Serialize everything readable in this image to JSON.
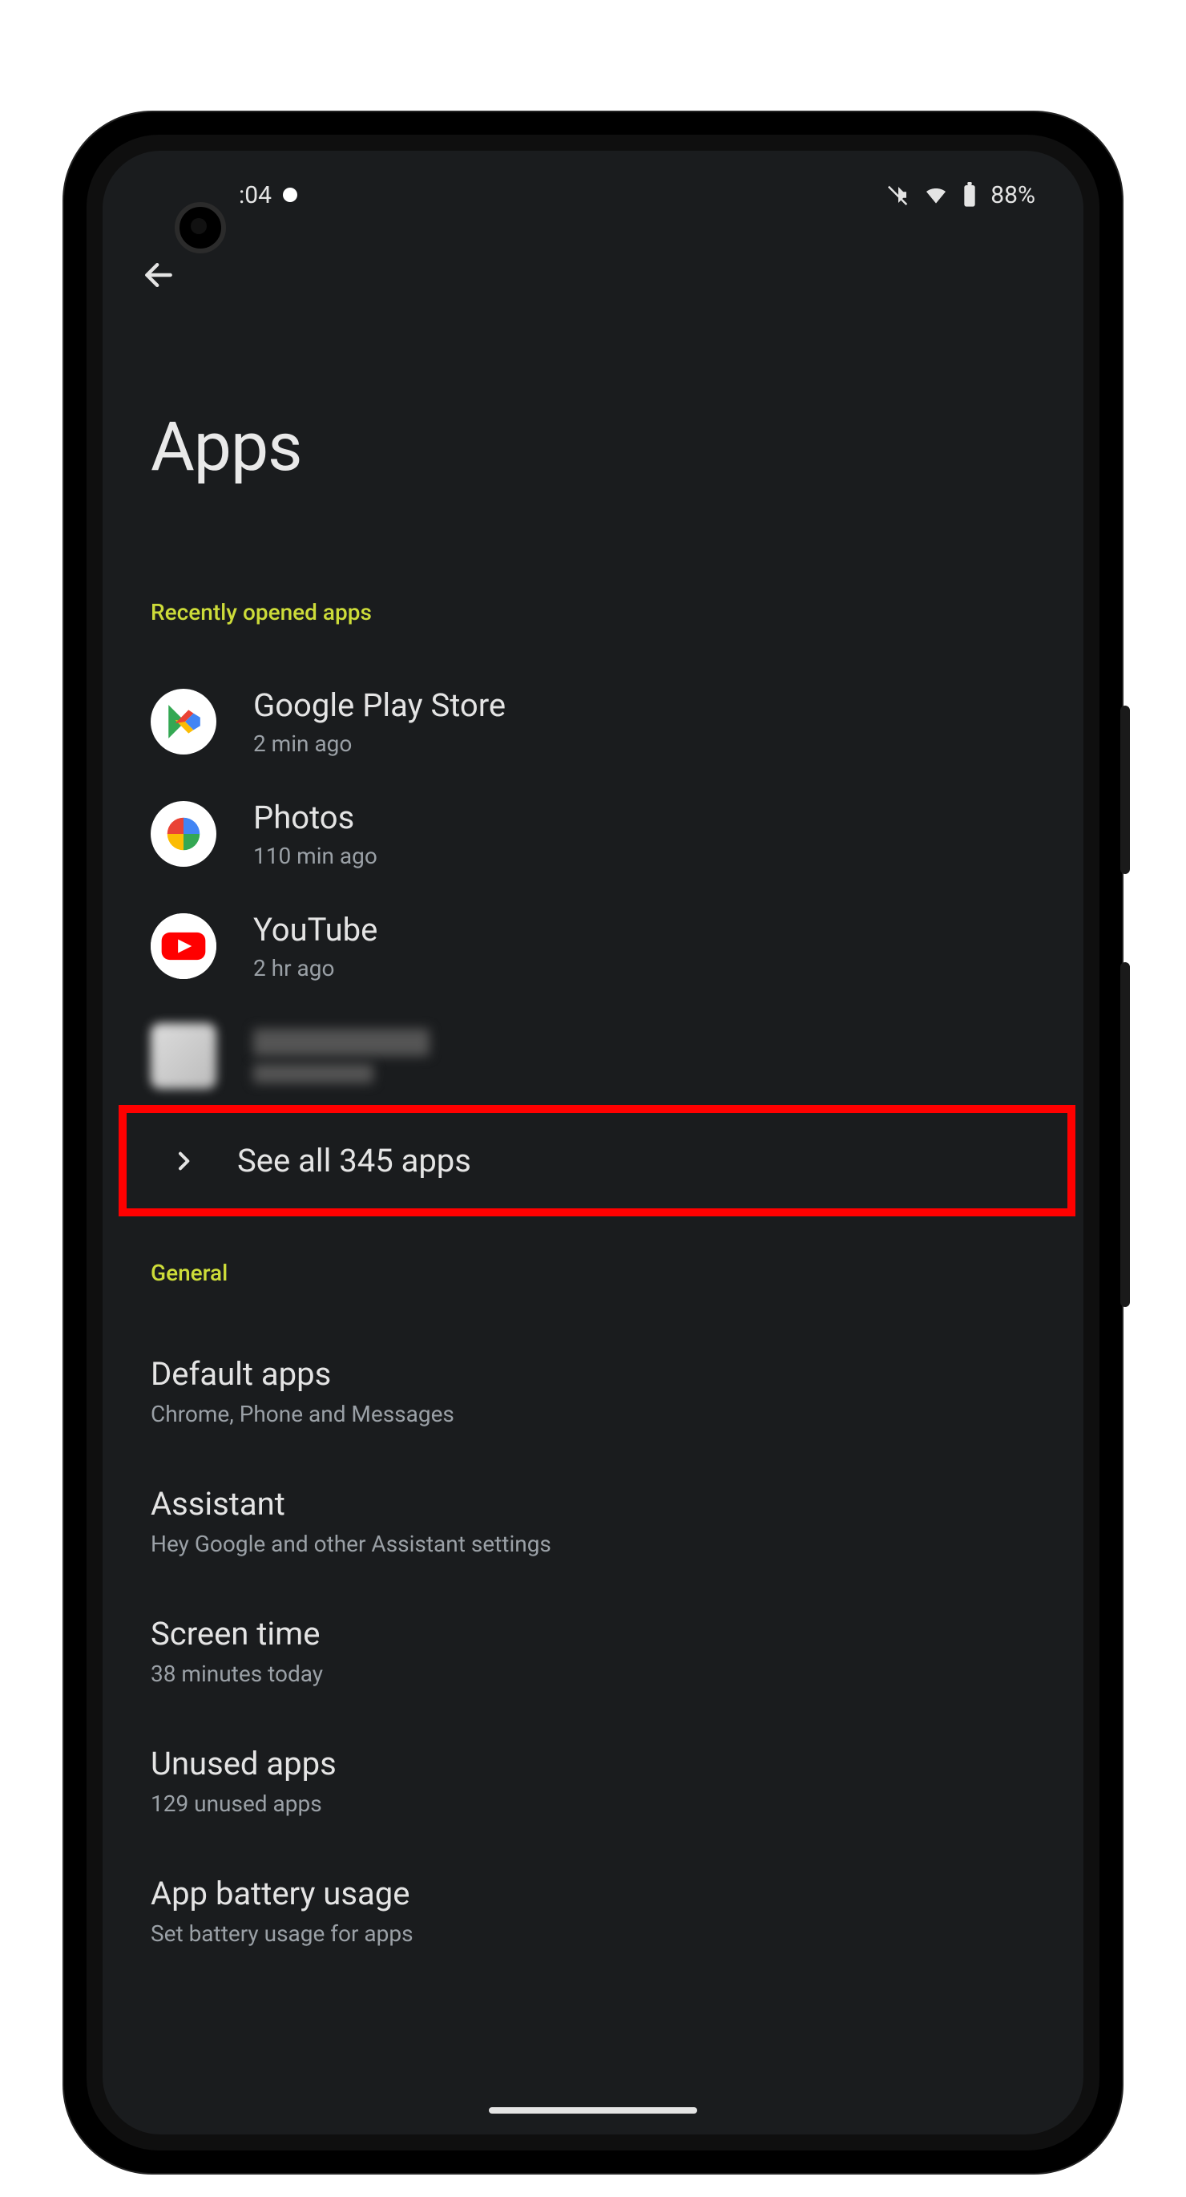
{
  "status": {
    "time": ":04",
    "battery": "88%"
  },
  "page": {
    "title": "Apps"
  },
  "recent": {
    "label": "Recently opened apps",
    "items": [
      {
        "name": "Google Play Store",
        "sub": "2 min ago",
        "icon": "play-store"
      },
      {
        "name": "Photos",
        "sub": "110 min ago",
        "icon": "google-photos"
      },
      {
        "name": "YouTube",
        "sub": "2 hr ago",
        "icon": "youtube"
      },
      {
        "name": "",
        "sub": "",
        "icon": "blurred"
      }
    ],
    "see_all": "See all 345 apps"
  },
  "general": {
    "label": "General",
    "items": [
      {
        "title": "Default apps",
        "sub": "Chrome, Phone and Messages"
      },
      {
        "title": "Assistant",
        "sub": "Hey Google and other Assistant settings"
      },
      {
        "title": "Screen time",
        "sub": "38 minutes today"
      },
      {
        "title": "Unused apps",
        "sub": "129 unused apps"
      },
      {
        "title": "App battery usage",
        "sub": "Set battery usage for apps"
      }
    ]
  },
  "highlight": {
    "target": "see-all-apps"
  }
}
